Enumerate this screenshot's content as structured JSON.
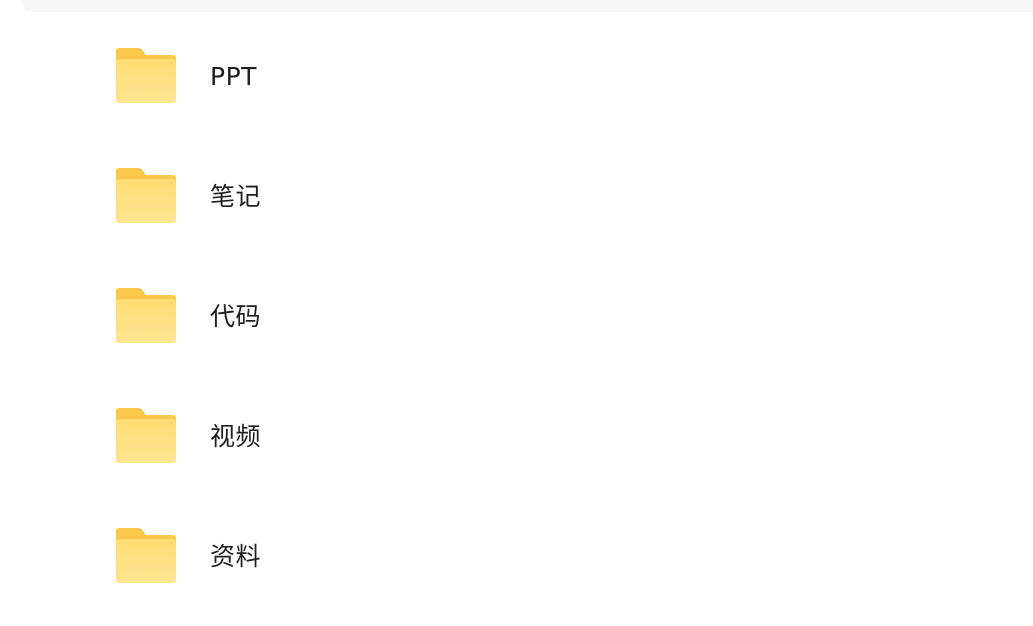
{
  "folders": [
    {
      "label": "PPT",
      "icon": "folder-icon"
    },
    {
      "label": "笔记",
      "icon": "folder-icon"
    },
    {
      "label": "代码",
      "icon": "folder-icon"
    },
    {
      "label": "视频",
      "icon": "folder-icon"
    },
    {
      "label": "资料",
      "icon": "folder-icon"
    }
  ],
  "colors": {
    "folder_back": "#f8c94a",
    "folder_front_top": "#ffdc73",
    "folder_front_bottom": "#ffe592",
    "label_text": "#1f1f1f",
    "top_panel": "#f5f6f8"
  }
}
